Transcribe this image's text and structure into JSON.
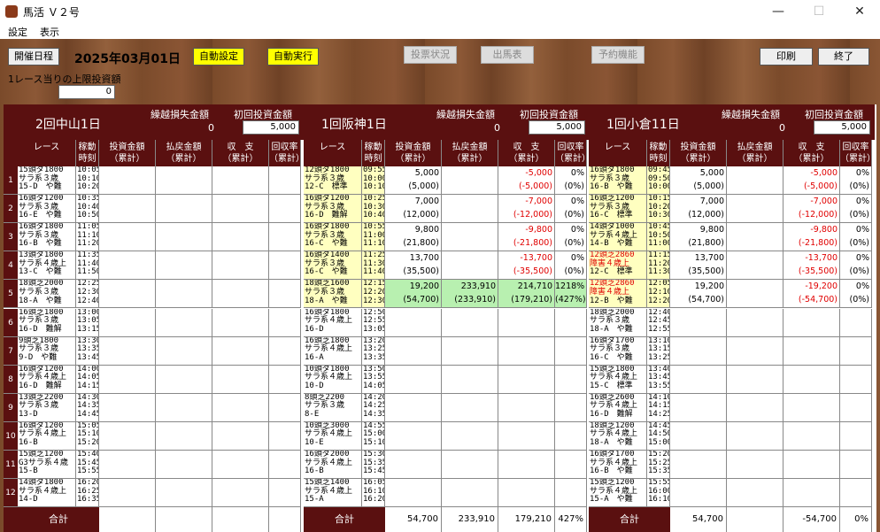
{
  "window": {
    "title": "馬活 Ｖ２号",
    "min": "—",
    "max": "☐",
    "close": "✕"
  },
  "menu": [
    "設定",
    "表示"
  ],
  "toolbar": {
    "schedule": "開催日程",
    "date": "2025年03月01日",
    "auto_setting": "自動設定",
    "auto_run": "自動実行",
    "vote_status": "投票状況",
    "entries": "出馬表",
    "reserve": "予約機能",
    "print": "印刷",
    "exit": "終了"
  },
  "limit": {
    "label": "1レース当りの上限投資額",
    "value": "0"
  },
  "col_labels": {
    "race": "レース",
    "time": "稼動\n時刻",
    "invest": "投資金額\n（累計）",
    "payout": "払戻金額\n（累計）",
    "balance": "収　支\n（累計）",
    "rate": "回収率\n（累計）",
    "carry": "繰越損失金額",
    "initial": "初回投資金額",
    "total": "合計"
  },
  "panels": [
    {
      "name": "2回中山1日",
      "carry": "0",
      "initial": "5,000",
      "races": [
        {
          "r": [
            "15頭ダ1800",
            "サラ系３歳",
            "15-D　や難"
          ],
          "t": [
            "10:05",
            "10:10",
            "10:20"
          ]
        },
        {
          "r": [
            "16頭ダ1200",
            "サラ系３歳",
            "16-E　や難"
          ],
          "t": [
            "10:35",
            "10:40",
            "10:50"
          ]
        },
        {
          "r": [
            "16頭ダ1800",
            "サラ系３歳",
            "16-B　や難"
          ],
          "t": [
            "11:05",
            "11:10",
            "11:20"
          ]
        },
        {
          "r": [
            "13頭ダ1800",
            "サラ系４歳上",
            "13-C　や難"
          ],
          "t": [
            "11:35",
            "11:40",
            "11:50"
          ]
        },
        {
          "r": [
            "18頭芝2000",
            "サラ系３歳",
            "18-A　や難"
          ],
          "t": [
            "12:25",
            "12:30",
            "12:40"
          ]
        },
        {
          "r": [
            "16頭芝1800",
            "サラ系３歳",
            "16-D　難解"
          ],
          "t": [
            "13:00",
            "13:05",
            "13:15"
          ]
        },
        {
          "r": [
            "9頭芝1800",
            "サラ系３歳",
            "9-D　や難"
          ],
          "t": [
            "13:30",
            "13:35",
            "13:45"
          ]
        },
        {
          "r": [
            "16頭ダ1200",
            "サラ系４歳上",
            "16-D　難解"
          ],
          "t": [
            "14:00",
            "14:05",
            "14:15"
          ]
        },
        {
          "r": [
            "13頭芝2200",
            "サラ系３歳",
            "13-D"
          ],
          "t": [
            "14:30",
            "14:35",
            "14:45"
          ]
        },
        {
          "r": [
            "16頭ダ1200",
            "サラ系４歳上",
            "16-B"
          ],
          "t": [
            "15:05",
            "15:10",
            "15:20"
          ]
        },
        {
          "r": [
            "15頭芝1200",
            "G3サラ系４歳",
            "15-B"
          ],
          "t": [
            "15:40",
            "15:45",
            "15:55"
          ]
        },
        {
          "r": [
            "14頭ダ1800",
            "サラ系４歳上",
            "14-D"
          ],
          "t": [
            "16:20",
            "16:25",
            "16:35"
          ]
        }
      ],
      "vals": [],
      "totals": {
        "invest": "",
        "payout": "",
        "balance": "",
        "rate": ""
      }
    },
    {
      "name": "1回阪神1日",
      "carry": "0",
      "initial": "5,000",
      "races": [
        {
          "r": [
            "12頭ダ1800",
            "サラ系３歳",
            "12-C　標準"
          ],
          "t": [
            "09:55",
            "10:00",
            "10:10"
          ],
          "hl": "y"
        },
        {
          "r": [
            "16頭ダ1200",
            "サラ系３歳",
            "16-D　難解"
          ],
          "t": [
            "10:25",
            "10:30",
            "10:40"
          ],
          "hl": "y"
        },
        {
          "r": [
            "16頭ダ1800",
            "サラ系３歳",
            "16-C　や難"
          ],
          "t": [
            "10:55",
            "11:00",
            "11:10"
          ],
          "hl": "y"
        },
        {
          "r": [
            "16頭ダ1400",
            "サラ系３歳",
            "16-C　や難"
          ],
          "t": [
            "11:25",
            "11:30",
            "11:40"
          ],
          "hl": "y"
        },
        {
          "r": [
            "18頭芝1600",
            "サラ系３歳",
            "18-A　や難"
          ],
          "t": [
            "12:15",
            "12:20",
            "12:30"
          ],
          "hl": "y"
        },
        {
          "r": [
            "16頭ダ1800",
            "サラ系４歳上",
            "16-D"
          ],
          "t": [
            "12:50",
            "12:55",
            "13:05"
          ]
        },
        {
          "r": [
            "16頭芝1800",
            "サラ系４歳上",
            "16-A"
          ],
          "t": [
            "13:20",
            "13:25",
            "13:35"
          ]
        },
        {
          "r": [
            "10頭ダ1800",
            "サラ系４歳上",
            "10-D"
          ],
          "t": [
            "13:50",
            "13:55",
            "14:05"
          ]
        },
        {
          "r": [
            "8頭芝2200",
            "サラ系３歳",
            "8-E"
          ],
          "t": [
            "14:20",
            "14:25",
            "14:35"
          ]
        },
        {
          "r": [
            "10頭芝3000",
            "サラ系４歳上",
            "10-E"
          ],
          "t": [
            "14:55",
            "15:00",
            "15:10"
          ]
        },
        {
          "r": [
            "16頭ダ2000",
            "サラ系４歳上",
            "16-B"
          ],
          "t": [
            "15:30",
            "15:35",
            "15:45"
          ]
        },
        {
          "r": [
            "15頭芝1400",
            "サラ系４歳上",
            "15-A"
          ],
          "t": [
            "16:05",
            "16:10",
            "16:20"
          ]
        }
      ],
      "vals": [
        {
          "inv": [
            "5,000",
            "(5,000)"
          ],
          "pay": [
            "",
            ""
          ],
          "bal": [
            "-5,000",
            "(-5,000)"
          ],
          "rate": [
            "0%",
            "(0%)"
          ]
        },
        {
          "inv": [
            "7,000",
            "(12,000)"
          ],
          "pay": [
            "",
            ""
          ],
          "bal": [
            "-7,000",
            "(-12,000)"
          ],
          "rate": [
            "0%",
            "(0%)"
          ]
        },
        {
          "inv": [
            "9,800",
            "(21,800)"
          ],
          "pay": [
            "",
            ""
          ],
          "bal": [
            "-9,800",
            "(-21,800)"
          ],
          "rate": [
            "0%",
            "(0%)"
          ]
        },
        {
          "inv": [
            "13,700",
            "(35,500)"
          ],
          "pay": [
            "",
            ""
          ],
          "bal": [
            "-13,700",
            "(-35,500)"
          ],
          "rate": [
            "0%",
            "(0%)"
          ]
        },
        {
          "inv": [
            "19,200",
            "(54,700)"
          ],
          "pay": [
            "233,910",
            "(233,910)"
          ],
          "bal": [
            "214,710",
            "(179,210)"
          ],
          "rate": [
            "1218%",
            "(427%)"
          ],
          "win": true
        }
      ],
      "totals": {
        "invest": "54,700",
        "payout": "233,910",
        "balance": "179,210",
        "rate": "427%"
      }
    },
    {
      "name": "1回小倉11日",
      "carry": "0",
      "initial": "5,000",
      "races": [
        {
          "r": [
            "16頭ダ1800",
            "サラ系３歳",
            "16-B　や難"
          ],
          "t": [
            "09:45",
            "09:50",
            "10:00"
          ],
          "hl": "y"
        },
        {
          "r": [
            "16頭芝1200",
            "サラ系３歳",
            "16-C　標準"
          ],
          "t": [
            "10:15",
            "10:20",
            "10:30"
          ],
          "hl": "y"
        },
        {
          "r": [
            "14頭ダ1000",
            "サラ系４歳上",
            "14-B　や難"
          ],
          "t": [
            "10:45",
            "10:50",
            "11:00"
          ],
          "hl": "y"
        },
        {
          "r": [
            "12頭芝2860",
            "障害４歳上",
            "12-C　標準"
          ],
          "t": [
            "11:15",
            "11:20",
            "11:30"
          ],
          "hl": "y",
          "red": true
        },
        {
          "r": [
            "12頭芝2860",
            "障害４歳上",
            "12-B　や難"
          ],
          "t": [
            "12:05",
            "12:10",
            "12:20"
          ],
          "hl": "y",
          "red": true
        },
        {
          "r": [
            "18頭芝2000",
            "サラ系３歳",
            "18-A　や難"
          ],
          "t": [
            "12:40",
            "12:45",
            "12:55"
          ]
        },
        {
          "r": [
            "16頭ダ1700",
            "サラ系３歳",
            "16-C　や難"
          ],
          "t": [
            "13:10",
            "13:15",
            "13:25"
          ]
        },
        {
          "r": [
            "15頭芝1800",
            "サラ系４歳上",
            "15-C　標準"
          ],
          "t": [
            "13:40",
            "13:45",
            "13:55"
          ]
        },
        {
          "r": [
            "16頭芝2600",
            "サラ系４歳上",
            "16-D　難解"
          ],
          "t": [
            "14:10",
            "14:15",
            "14:25"
          ]
        },
        {
          "r": [
            "18頭芝1200",
            "サラ系４歳上",
            "18-A　や難"
          ],
          "t": [
            "14:45",
            "14:50",
            "15:00"
          ]
        },
        {
          "r": [
            "16頭ダ1700",
            "サラ系４歳上",
            "16-B　や難"
          ],
          "t": [
            "15:20",
            "15:25",
            "15:35"
          ]
        },
        {
          "r": [
            "15頭芝1200",
            "サラ系４歳上",
            "15-A　や難"
          ],
          "t": [
            "15:55",
            "16:00",
            "16:10"
          ]
        }
      ],
      "vals": [
        {
          "inv": [
            "5,000",
            "(5,000)"
          ],
          "pay": [
            "",
            ""
          ],
          "bal": [
            "-5,000",
            "(-5,000)"
          ],
          "rate": [
            "0%",
            "(0%)"
          ]
        },
        {
          "inv": [
            "7,000",
            "(12,000)"
          ],
          "pay": [
            "",
            ""
          ],
          "bal": [
            "-7,000",
            "(-12,000)"
          ],
          "rate": [
            "0%",
            "(0%)"
          ]
        },
        {
          "inv": [
            "9,800",
            "(21,800)"
          ],
          "pay": [
            "",
            ""
          ],
          "bal": [
            "-9,800",
            "(-21,800)"
          ],
          "rate": [
            "0%",
            "(0%)"
          ]
        },
        {
          "inv": [
            "13,700",
            "(35,500)"
          ],
          "pay": [
            "",
            ""
          ],
          "bal": [
            "-13,700",
            "(-35,500)"
          ],
          "rate": [
            "0%",
            "(0%)"
          ]
        },
        {
          "inv": [
            "19,200",
            "(54,700)"
          ],
          "pay": [
            "",
            ""
          ],
          "bal": [
            "-19,200",
            "(-54,700)"
          ],
          "rate": [
            "0%",
            "(0%)"
          ]
        }
      ],
      "totals": {
        "invest": "54,700",
        "payout": "",
        "balance": "-54,700",
        "rate": "0%"
      }
    }
  ],
  "row_numbers": [
    "1",
    "2",
    "3",
    "4",
    "5",
    "6",
    "7",
    "8",
    "9",
    "10",
    "11",
    "12"
  ]
}
